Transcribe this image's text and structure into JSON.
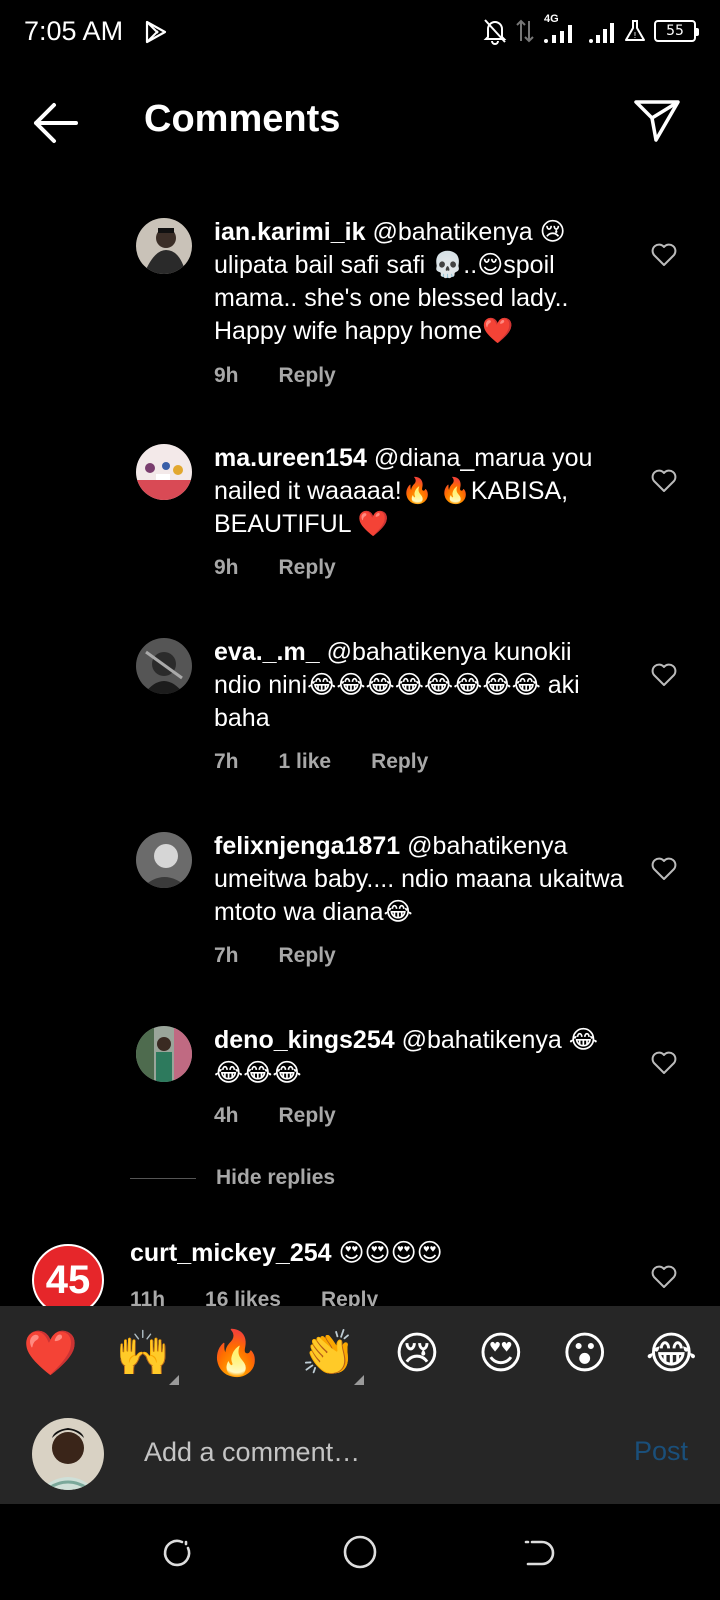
{
  "status_bar": {
    "time": "7:05 AM",
    "network": "4G",
    "battery": "55"
  },
  "header": {
    "title": "Comments"
  },
  "comments": [
    {
      "username": "ian.karimi_ik",
      "text": "@bahatikenya 😢 ulipata bail safi safi 💀..😌spoil mama.. she's one blessed lady.. Happy wife happy home❤️",
      "time": "9h",
      "likes": "",
      "reply": "Reply"
    },
    {
      "username": "ma.ureen154",
      "text": "@diana_marua you nailed it waaaaa!🔥 🔥KABISA, BEAUTIFUL ❤️",
      "time": "9h",
      "likes": "",
      "reply": "Reply"
    },
    {
      "username": "eva._.m_",
      "text": "@bahatikenya kunokii ndio nini😂😂😂😂😂😂😂😂 aki baha",
      "time": "7h",
      "likes": "1 like",
      "reply": "Reply"
    },
    {
      "username": "felixnjenga1871",
      "text": "@bahatikenya umeitwa baby.... ndio maana ukaitwa mtoto wa diana😂",
      "time": "7h",
      "likes": "",
      "reply": "Reply"
    },
    {
      "username": "deno_kings254",
      "text": "@bahatikenya 😂😂😂😂",
      "time": "4h",
      "likes": "",
      "reply": "Reply"
    }
  ],
  "hide_replies": "Hide replies",
  "top_comment": {
    "avatar_text": "45",
    "username": "curt_mickey_254",
    "text": "😍😍😍😍",
    "time": "11h",
    "likes": "16 likes",
    "reply": "Reply"
  },
  "emoji_bar": [
    "❤️",
    "🙌",
    "🔥",
    "👏",
    "😢",
    "😍",
    "😮",
    "😂"
  ],
  "comment_input": {
    "placeholder": "Add a comment…",
    "post_label": "Post"
  },
  "colors": {
    "background": "#000000",
    "panel": "#262626",
    "meta_text": "#a8a8a8",
    "post_disabled": "#1a4f7a",
    "badge_red": "#e6262a"
  }
}
